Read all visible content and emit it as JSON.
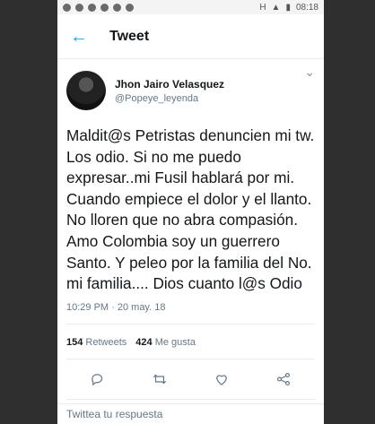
{
  "status": {
    "time": "08:18",
    "network": "H"
  },
  "header": {
    "title": "Tweet"
  },
  "tweet": {
    "display_name": "Jhon Jairo Velasquez",
    "handle": "@Popeye_leyenda",
    "text": "Maldit@s Petristas denuncien mi tw.  Los odio. Si no me puedo expresar..mi Fusil hablará por mi. Cuando empiece el dolor y el llanto. No lloren que no abra compasión. Amo Colombia soy un guerrero Santo. Y peleo por la familia del No. mi familia....  Dios cuanto l@s Odio",
    "timestamp": "10:29 PM · 20 may. 18",
    "retweets_count": "154",
    "retweets_label": "Retweets",
    "likes_count": "424",
    "likes_label": "Me gusta"
  },
  "reply": {
    "placeholder": "Twittea tu respuesta"
  }
}
